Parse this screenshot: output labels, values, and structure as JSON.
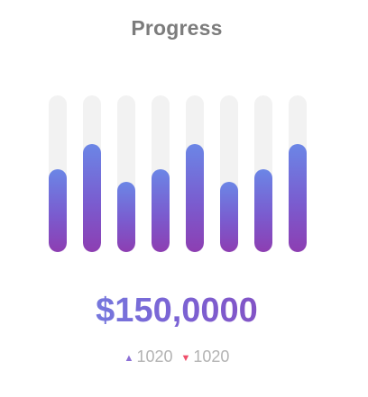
{
  "card": {
    "title": "Progress",
    "amount": "$150,0000",
    "increase": {
      "icon": "triangle-up-icon",
      "value": "1020"
    },
    "decrease": {
      "icon": "triangle-down-icon",
      "value": "1020"
    }
  },
  "progress_bars": {
    "levels_percent": [
      53,
      69,
      45,
      53,
      69,
      45,
      53,
      69
    ],
    "fill_gradient": [
      "#6b86e6",
      "#7a5ccf",
      "#8d3eb2"
    ],
    "track_color": "#f2f2f2"
  },
  "colors": {
    "title": "#7c7c7c",
    "increase_arrow": "#8b6fd6",
    "decrease_arrow": "#ef4f6b",
    "stat_text": "#b3b3b3"
  }
}
